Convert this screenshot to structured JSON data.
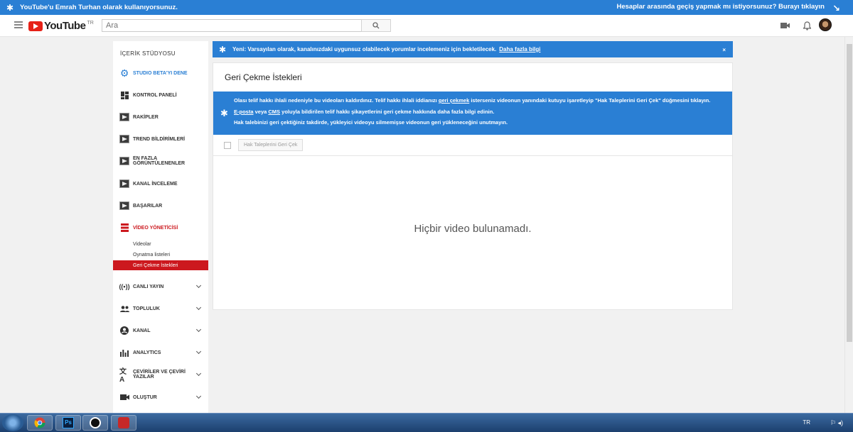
{
  "topbar": {
    "left_text": "YouTube'u Emrah Turhan olarak kullanıyorsunuz.",
    "right_text": "Hesaplar arasında geçiş yapmak mı istiyorsunuz? Burayı tıklayın"
  },
  "masthead": {
    "logo_text": "YouTube",
    "logo_region": "TR",
    "search_placeholder": "Ara"
  },
  "sidebar": {
    "title": "İÇERİK STÜDYOSU",
    "items": [
      {
        "label": "STUDIO BETA'YI DENE"
      },
      {
        "label": "KONTROL PANELİ"
      },
      {
        "label": "RAKİPLER"
      },
      {
        "label": "TREND BİLDİRİMLERİ"
      },
      {
        "label_line1": "EN FAZLA",
        "label_line2": "GÖRÜNTÜLENENLER"
      },
      {
        "label": "KANAL İNCELEME"
      },
      {
        "label": "BAŞARILAR"
      },
      {
        "label": "VİDEO YÖNETİCİSİ"
      },
      {
        "label": "CANLI YAYIN"
      },
      {
        "label": "TOPLULUK"
      },
      {
        "label": "KANAL"
      },
      {
        "label": "ANALYTICS"
      },
      {
        "label_line1": "ÇEVİRİLER VE ÇEVİRİ",
        "label_line2": "YAZILAR"
      },
      {
        "label": "OLUŞTUR"
      }
    ],
    "sub_items": [
      "Videolar",
      "Oynatma listeleri",
      "Geri Çekme İstekleri"
    ]
  },
  "notice": {
    "text": "Yeni: Varsayılan olarak, kanalınızdaki uygunsuz olabilecek yorumlar incelemeniz için bekletilecek.",
    "link": "Daha fazla bilgi",
    "close": "×"
  },
  "panel": {
    "title": "Geri Çekme İstekleri",
    "info": {
      "line1_a": "Olası telif hakkı ihlali nedeniyle bu videoları kaldırdınız. Telif hakkı ihlali iddianızı",
      "line1_link": "geri çekmek",
      "line1_b": "isterseniz videonun yanındaki kutuyu işaretleyip \"Hak Taleplerini Geri Çek\" düğmesini tıklayın.",
      "line2_link1": "E-posta",
      "line2_mid": "veya",
      "line2_link2": "CMS",
      "line2_b": "yoluyla bildirilen telif hakkı şikayetlerini geri çekme hakkında daha fazla bilgi edinin.",
      "line3": "Hak talebinizi geri çektiğiniz takdirde, yükleyici videoyu silmemişse videonun geri yükleneceğini unutmayın."
    },
    "retract_button": "Hak Taleplerini Geri Çek",
    "empty_message": "Hiçbir video bulunamadı."
  },
  "taskbar": {
    "lang": "TR"
  },
  "colors": {
    "accent_blue": "#2a7fd4",
    "youtube_red": "#cc181e"
  }
}
